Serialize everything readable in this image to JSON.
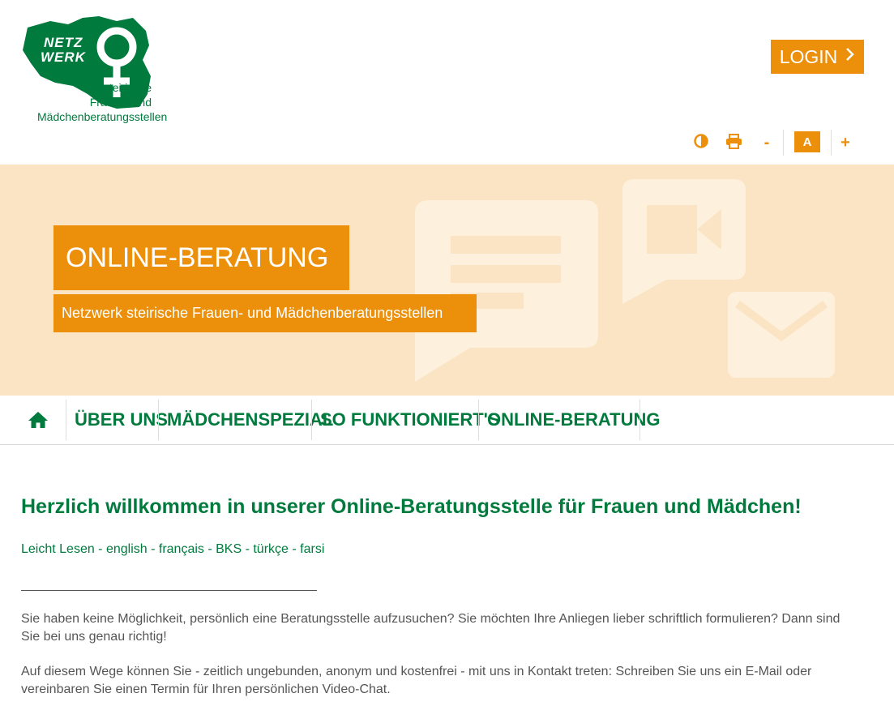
{
  "header": {
    "logo": {
      "name_line1": "NETZ",
      "name_line2": "WERK",
      "line1": "steirische",
      "line2": "Frauen- und",
      "line3": "Mädchenberatungsstellen",
      "icon": "female-symbol-icon"
    },
    "login_label": "LOGIN",
    "login_icon": "chevron-right-icon",
    "tools": {
      "contrast_icon": "contrast-icon",
      "print_icon": "print-icon",
      "decrease_label": "-",
      "font_label": "A",
      "increase_label": "+"
    }
  },
  "banner": {
    "title": "ONLINE-BERATUNG",
    "subtitle": "Netzwerk steirische Frauen- und Mädchenberatungsstellen",
    "icons": [
      "chat-bubble-icon",
      "video-camera-icon",
      "envelope-icon"
    ]
  },
  "nav": {
    "home_icon": "home-icon",
    "items": [
      {
        "label": "ÜBER UNS"
      },
      {
        "label": "MÄDCHENSPEZIAL"
      },
      {
        "label": "SO FUNKTIONIERT'S"
      },
      {
        "label": "ONLINE-BERATUNG"
      }
    ]
  },
  "content": {
    "heading": "Herzlich willkommen in unserer Online-Beratungsstelle für Frauen und Mädchen!",
    "languages": [
      {
        "label": "Leicht Lesen"
      },
      {
        "label": "english"
      },
      {
        "label": "français"
      },
      {
        "label": "BKS"
      },
      {
        "label": "türkçe"
      },
      {
        "label": "farsi"
      }
    ],
    "separator": " - ",
    "paragraph1": "Sie haben keine  Möglichkeit, persönlich eine Beratungsstelle aufzusuchen? Sie möchten Ihre Anliegen lieber schriftlich formulieren? Dann sind Sie bei uns genau richtig!",
    "paragraph2": "Auf diesem Wege können Sie - zeitlich ungebunden, anonym und kostenfrei - mit uns in Kontakt treten: Schreiben Sie uns ein E-Mail oder vereinbaren Sie einen Termin für Ihren persönlichen Video-Chat."
  },
  "colors": {
    "orange": "#ec8f0b",
    "green": "#007a3d",
    "banner_bg": "#fbe4c4",
    "banner_icons": "#fdf0dd"
  }
}
